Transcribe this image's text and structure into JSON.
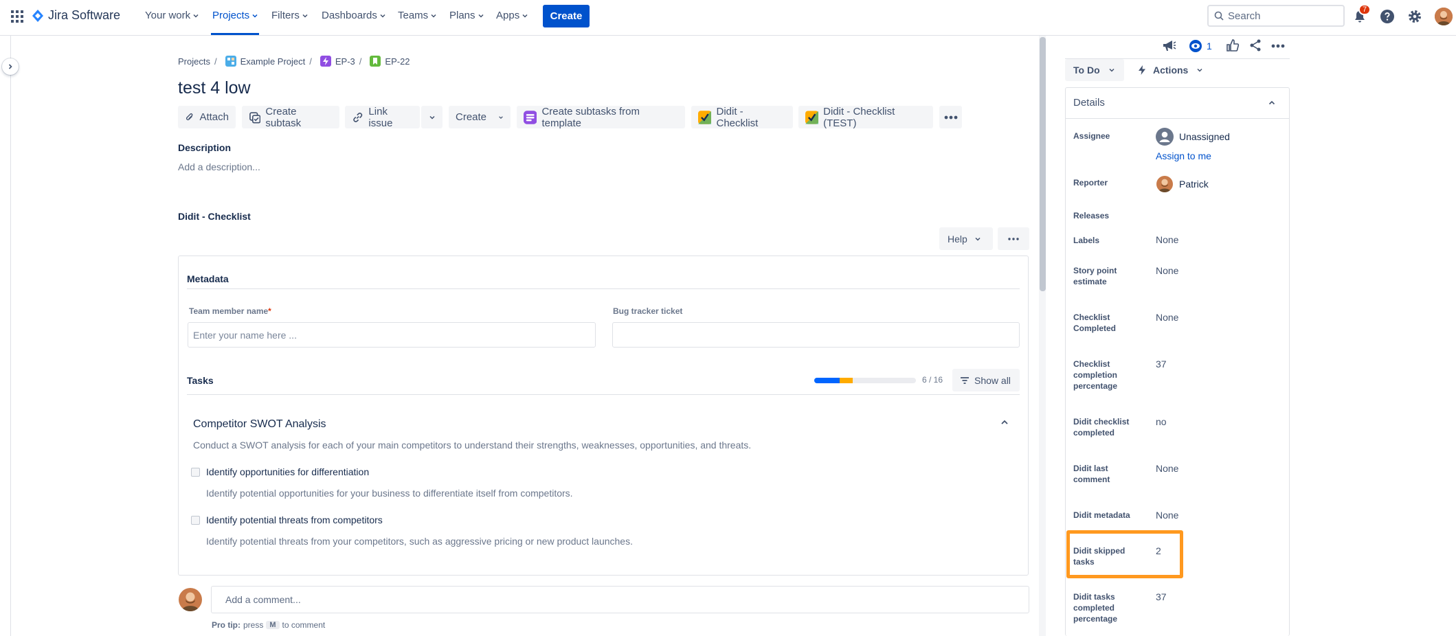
{
  "nav": {
    "brand": "Jira Software",
    "items": [
      {
        "label": "Your work"
      },
      {
        "label": "Projects"
      },
      {
        "label": "Filters"
      },
      {
        "label": "Dashboards"
      },
      {
        "label": "Teams"
      },
      {
        "label": "Plans"
      },
      {
        "label": "Apps"
      }
    ],
    "create_label": "Create",
    "search_placeholder": "Search",
    "notification_count": "7"
  },
  "breadcrumb": {
    "projects": "Projects",
    "project": "Example Project",
    "epic": "EP-3",
    "issue": "EP-22"
  },
  "issue": {
    "title": "test 4 low",
    "description_heading": "Description",
    "description_placeholder": "Add a description..."
  },
  "toolbar": {
    "attach": "Attach",
    "create_subtask": "Create subtask",
    "link_issue": "Link issue",
    "create": "Create",
    "create_from_template": "Create subtasks from template",
    "didit_checklist": "Didit - Checklist",
    "didit_checklist_test": "Didit - Checklist (TEST)"
  },
  "checklist": {
    "heading": "Didit - Checklist",
    "help": "Help",
    "metadata_heading": "Metadata",
    "team_member_label": "Team member name",
    "required_mark": "*",
    "team_member_placeholder": "Enter your name here ...",
    "bug_tracker_label": "Bug tracker ticket",
    "bug_tracker_value": "",
    "tasks_heading": "Tasks",
    "progress": {
      "done_fraction": 0.25,
      "skipped_fraction": 0.125,
      "text": "6 / 16"
    },
    "show_all": "Show all",
    "section_title": "Competitor SWOT Analysis",
    "section_desc": "Conduct a SWOT analysis for each of your main competitors to understand their strengths, weaknesses, opportunities, and threats.",
    "tasks": [
      {
        "title": "Identify opportunities for differentiation",
        "desc": "Identify potential opportunities for your business to differentiate itself from competitors."
      },
      {
        "title": "Identify potential threats from competitors",
        "desc": "Identify potential threats from your competitors, such as aggressive pricing or new product launches."
      }
    ]
  },
  "comment": {
    "placeholder": "Add a comment...",
    "tip_prefix": "Pro tip:",
    "tip_press": "press",
    "tip_key": "M",
    "tip_suffix": "to comment"
  },
  "sidebar": {
    "watch_count": "1",
    "status": "To Do",
    "actions": "Actions",
    "details_heading": "Details",
    "assignee_label": "Assignee",
    "assignee_value": "Unassigned",
    "assign_to_me": "Assign to me",
    "reporter_label": "Reporter",
    "reporter_value": "Patrick",
    "releases_label": "Releases",
    "labels_label": "Labels",
    "labels_value": "None",
    "story_label": "Story point estimate",
    "story_value": "None",
    "checklist_completed_label": "Checklist Completed",
    "checklist_completed_value": "None",
    "checklist_pct_label": "Checklist completion percentage",
    "checklist_pct_value": "37",
    "didit_completed_label": "Didit checklist completed",
    "didit_completed_value": "no",
    "didit_last_comment_label": "Didit last comment",
    "didit_last_comment_value": "None",
    "didit_metadata_label": "Didit metadata",
    "didit_metadata_value": "None",
    "didit_skipped_label": "Didit skipped tasks",
    "didit_skipped_value": "2",
    "didit_tasks_pct_label": "Didit tasks completed percentage",
    "didit_tasks_pct_value": "37"
  },
  "colors": {
    "primary": "#0052cc",
    "highlight": "#ff991f",
    "progress_done": "#0065ff",
    "progress_skipped": "#ffab00"
  }
}
